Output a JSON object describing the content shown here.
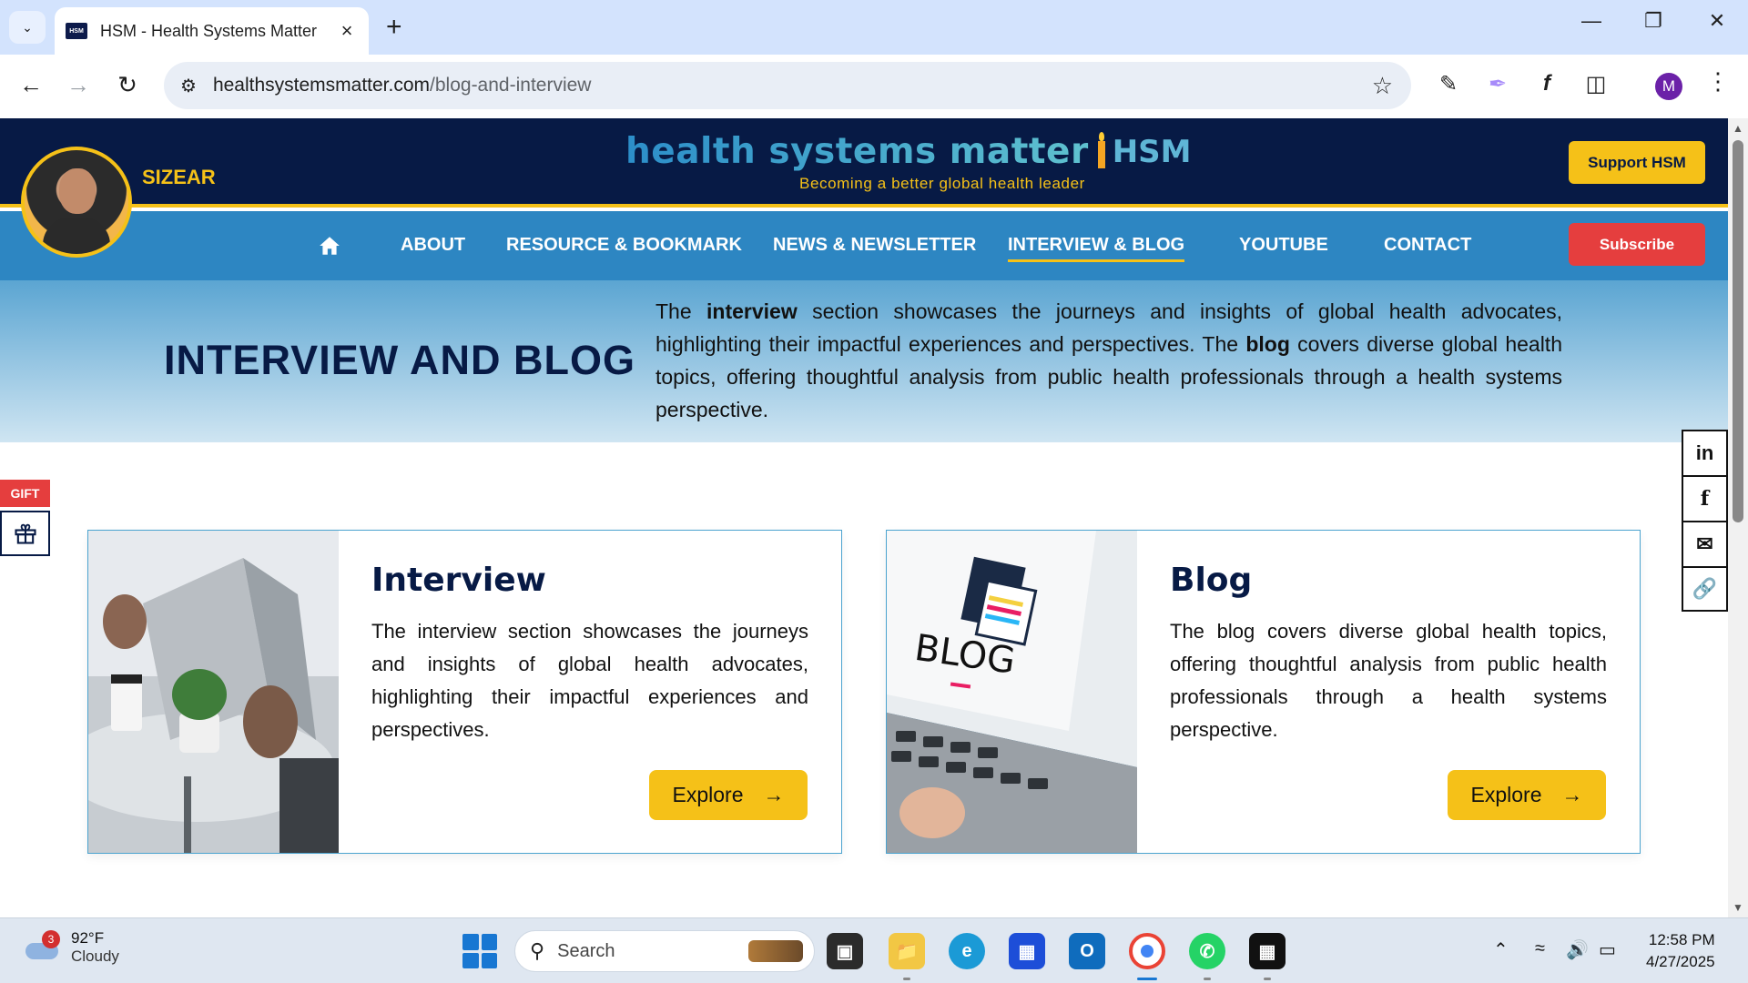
{
  "browser": {
    "tab_title": "HSM - Health Systems Matter",
    "favicon_text": "HSM",
    "url_host": "healthsystemsmatter.com",
    "url_path": "/blog-and-interview",
    "profile_initial": "M"
  },
  "header": {
    "username": "SIZEAR",
    "logo_text": "health systems matter",
    "logo_abbr": "HSM",
    "tagline": "Becoming a better global health leader",
    "support_label": "Support HSM"
  },
  "nav": {
    "items": [
      {
        "label": "ABOUT"
      },
      {
        "label": "RESOURCE & BOOKMARK"
      },
      {
        "label": "NEWS & NEWSLETTER"
      },
      {
        "label": "INTERVIEW & BLOG"
      },
      {
        "label": "YOUTUBE"
      },
      {
        "label": "CONTACT"
      }
    ],
    "active": "INTERVIEW & BLOG",
    "subscribe_label": "Subscribe"
  },
  "hero": {
    "title": "INTERVIEW AND BLOG",
    "desc_1": "The ",
    "desc_bold_1": "interview",
    "desc_2": " section showcases the journeys and insights of global health advocates, highlighting their impactful experiences and perspectives. The ",
    "desc_bold_2": "blog",
    "desc_3": " covers diverse global health topics, offering thoughtful analysis from public health professionals through a health systems perspective."
  },
  "sidebar": {
    "gift_label": "GIFT"
  },
  "cards": [
    {
      "title": "Interview",
      "desc": "The interview section showcases the journeys and insights of global health advocates, highlighting their impactful experiences and perspectives.",
      "button": "Explore"
    },
    {
      "title": "Blog",
      "desc": "The blog covers diverse global health topics, offering thoughtful analysis from public health professionals through a health systems perspective.",
      "button": "Explore",
      "image_text": "BLOG"
    }
  ],
  "taskbar": {
    "weather_temp": "92°F",
    "weather_cond": "Cloudy",
    "weather_badge": "3",
    "search_placeholder": "Search",
    "time": "12:58 PM",
    "date": "4/27/2025"
  },
  "colors": {
    "header_bg": "#071a45",
    "nav_bg": "#2d86c2",
    "accent_yellow": "#f5c118",
    "subscribe_red": "#e53e3e"
  }
}
